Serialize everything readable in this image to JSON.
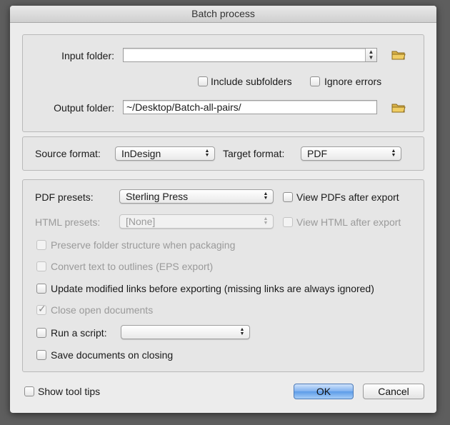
{
  "window": {
    "title": "Batch process"
  },
  "folders": {
    "input_label": "Input folder:",
    "input_value": "",
    "include_subfolders": {
      "label": "Include subfolders",
      "checked": false
    },
    "ignore_errors": {
      "label": "Ignore errors",
      "checked": false
    },
    "output_label": "Output folder:",
    "output_value": "~/Desktop/Batch-all-pairs/"
  },
  "formats": {
    "source_label": "Source format:",
    "source_value": "InDesign",
    "target_label": "Target format:",
    "target_value": "PDF"
  },
  "options": {
    "pdf_presets_label": "PDF presets:",
    "pdf_presets_value": "Sterling Press",
    "view_pdfs": {
      "label": "View PDFs after export",
      "checked": false
    },
    "html_presets_label": "HTML presets:",
    "html_presets_value": "[None]",
    "view_html": {
      "label": "View HTML after export",
      "checked": false,
      "disabled": true
    },
    "preserve_folder": {
      "label": "Preserve folder structure when packaging",
      "checked": false,
      "disabled": true
    },
    "convert_outlines": {
      "label": "Convert text to outlines (EPS export)",
      "checked": false,
      "disabled": true
    },
    "update_links": {
      "label": "Update modified links before exporting (missing links are always ignored)",
      "checked": false
    },
    "close_docs": {
      "label": "Close open documents",
      "checked": true,
      "disabled": true
    },
    "run_script": {
      "label": "Run a script:",
      "checked": false
    },
    "run_script_value": "",
    "save_docs": {
      "label": "Save documents on closing",
      "checked": false
    }
  },
  "footer": {
    "show_tooltips": {
      "label": "Show tool tips",
      "checked": false
    },
    "ok_label": "OK",
    "cancel_label": "Cancel"
  },
  "icons": {
    "folder": "folder-icon",
    "popup_arrows": "updown-arrows-icon",
    "check": "checkmark-icon"
  }
}
